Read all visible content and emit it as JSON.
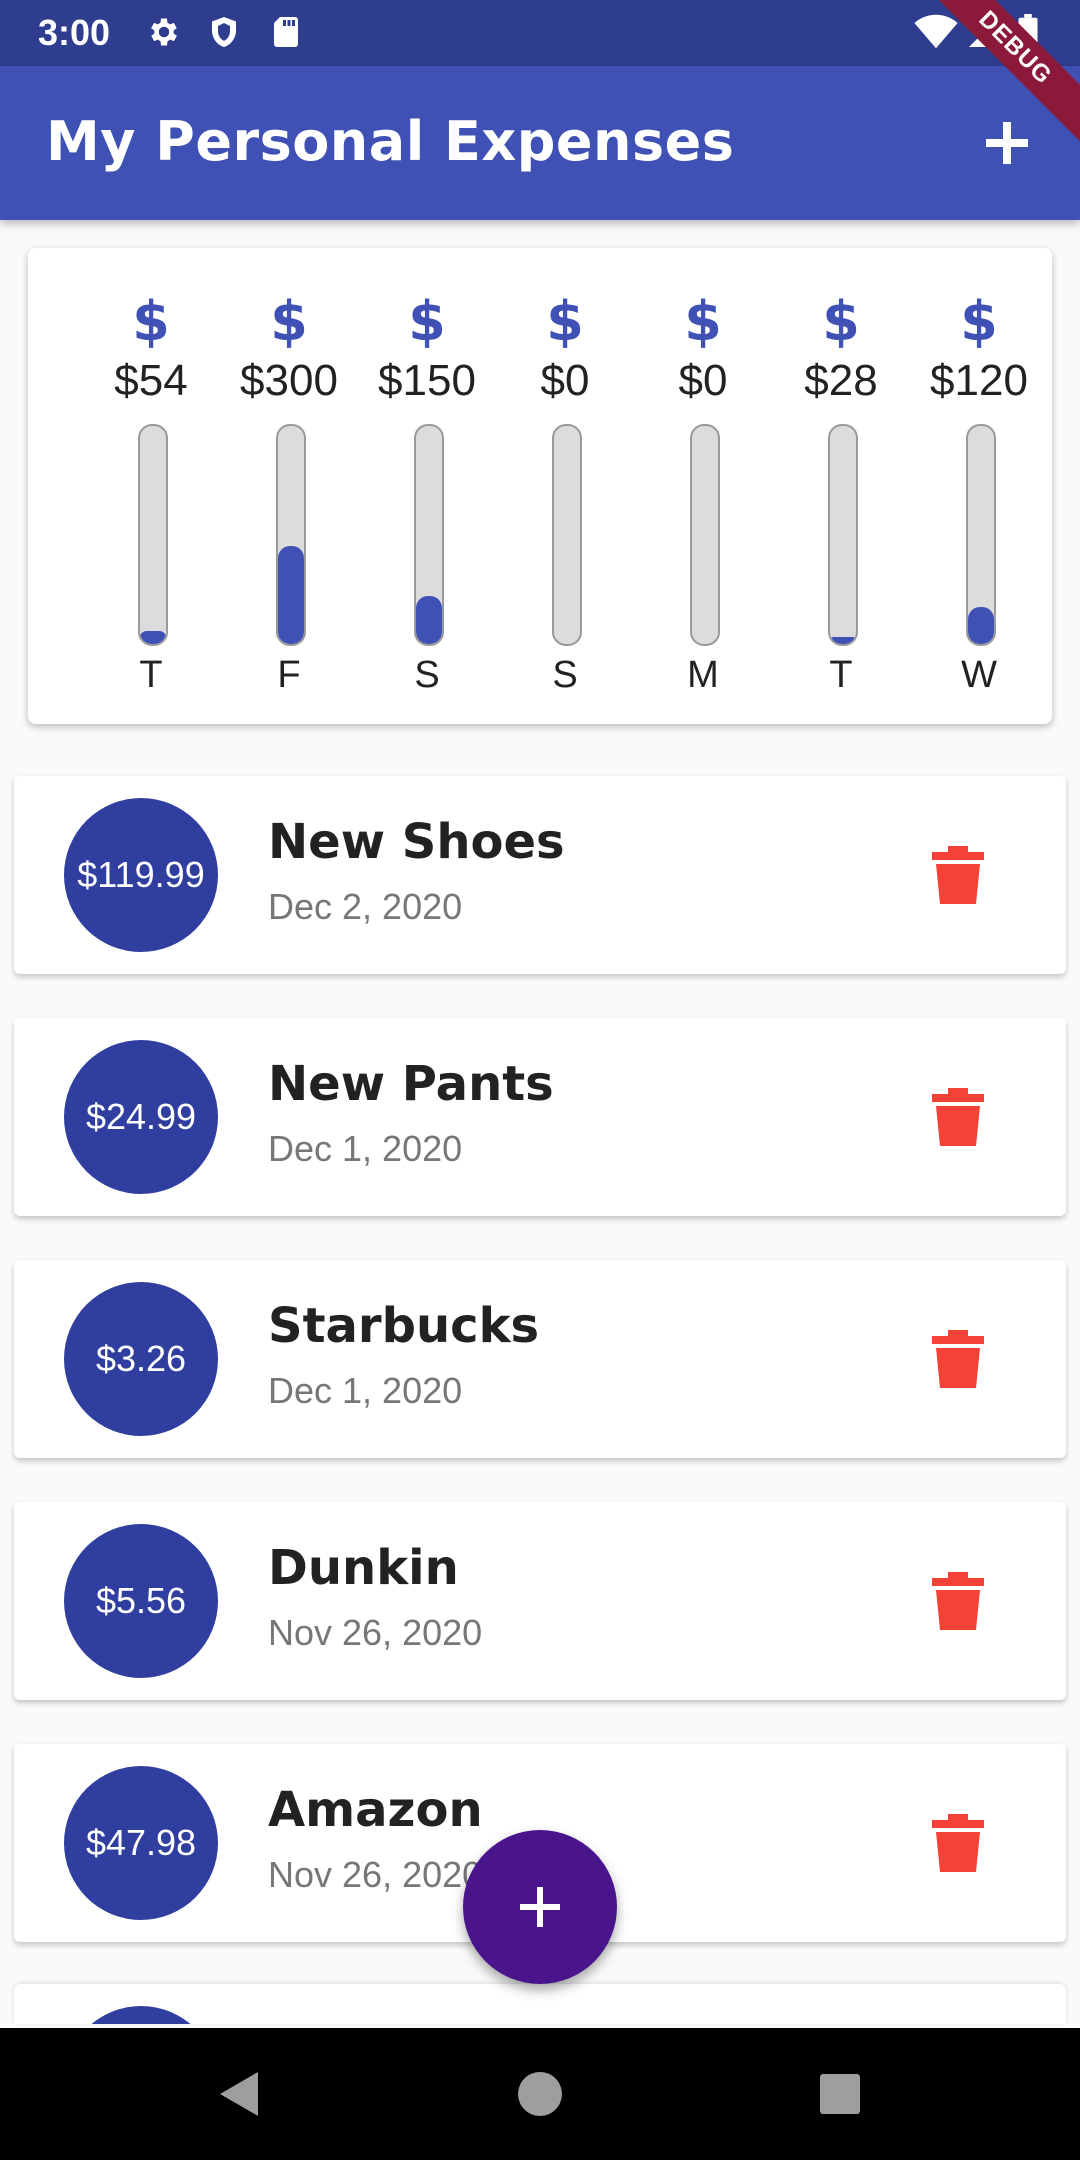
{
  "status_bar": {
    "time": "3:00",
    "left_icons": [
      "gear-icon",
      "shield-icon",
      "sd-card-icon"
    ],
    "right_icons": [
      "wifi-icon",
      "cell-signal-icon",
      "battery-icon"
    ]
  },
  "app_bar": {
    "title": "My Personal Expenses",
    "add_icon": "plus-icon",
    "debug_label": "DEBUG",
    "color": "#3f51b5"
  },
  "weekly_chart": {
    "currency_symbol": "$",
    "bar_color": "#3f51b5",
    "days": [
      {
        "day": "T",
        "amount": "$54",
        "fraction": 0.06
      },
      {
        "day": "F",
        "amount": "$300",
        "fraction": 0.45
      },
      {
        "day": "S",
        "amount": "$150",
        "fraction": 0.22
      },
      {
        "day": "S",
        "amount": "$0",
        "fraction": 0
      },
      {
        "day": "M",
        "amount": "$0",
        "fraction": 0
      },
      {
        "day": "T",
        "amount": "$28",
        "fraction": 0.03
      },
      {
        "day": "W",
        "amount": "$120",
        "fraction": 0.17
      }
    ]
  },
  "transactions": [
    {
      "amount": "$119.99",
      "title": "New Shoes",
      "date": "Dec 2, 2020"
    },
    {
      "amount": "$24.99",
      "title": "New Pants",
      "date": "Dec 1, 2020"
    },
    {
      "amount": "$3.26",
      "title": "Starbucks",
      "date": "Dec 1, 2020"
    },
    {
      "amount": "$5.56",
      "title": "Dunkin",
      "date": "Nov 26, 2020"
    },
    {
      "amount": "$47.98",
      "title": "Amazon",
      "date": "Nov 26, 2020"
    }
  ],
  "delete_icon": "trash-icon",
  "delete_color": "#f44336",
  "fab": {
    "icon": "plus-icon",
    "color": "#4a148c"
  },
  "nav_bar": {
    "icons": [
      "back-triangle-icon",
      "home-circle-icon",
      "recents-square-icon"
    ]
  }
}
